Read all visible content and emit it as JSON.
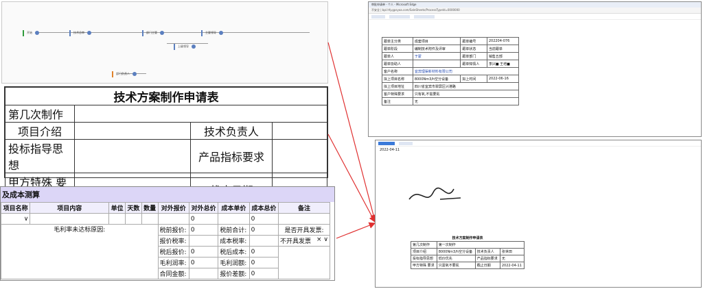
{
  "flow": {
    "nodes": [
      {
        "label": "开始"
      },
      {
        "label": "技术总审"
      },
      {
        "label": "部门主管"
      },
      {
        "label": "上级领导"
      },
      {
        "label": "主要领导"
      },
      {
        "label": "部门负责人"
      }
    ]
  },
  "request_form": {
    "title": "技术方案制作申请表",
    "rows": [
      {
        "label": "第几次制作",
        "right_label": ""
      },
      {
        "label": "项目介绍",
        "right_label": "技术负责人"
      },
      {
        "label": "投标指导思想",
        "right_label": "产品指标要求"
      },
      {
        "label": "甲方特殊 要求",
        "right_label": "截止日期"
      }
    ]
  },
  "cost": {
    "header": "及成本测算",
    "columns": [
      "项目名称",
      "项目内容",
      "单位",
      "天数",
      "数量",
      "对外报价",
      "对外总价",
      "成本单价",
      "成本总价",
      "备注"
    ],
    "row_values": {
      "quote_total": "0",
      "cost_total": "0"
    },
    "reason_label": "毛利率未达标原因:",
    "invoice_label": "是否开具发票:",
    "invoice_value": "不开具发票",
    "summary": [
      {
        "l1": "税前报价:",
        "v1": "0",
        "l2": "税前合计:",
        "v2": "0"
      },
      {
        "l1": "报价税率:",
        "v1": "",
        "l2": "成本税率:",
        "v2": ""
      },
      {
        "l1": "税后报价:",
        "v1": "0",
        "l2": "税后成本:",
        "v2": "0"
      },
      {
        "l1": "毛利润率:",
        "v1": "0",
        "l2": "毛利润额:",
        "v2": "0"
      },
      {
        "l1": "合同金额:",
        "v1": "",
        "l2": "报价差额:",
        "v2": "0"
      }
    ]
  },
  "window_a": {
    "title": "审批申请单 - 个人 - Microsoft Edge",
    "address": "不安全 | bpl.hfy.gpsyoa.com/SaleSheets/ProcessTypeId=0000000",
    "form": [
      {
        "l1": "跟单主分类",
        "v1": "成套项目",
        "l2": "跟单编号",
        "v2": "202204-076"
      },
      {
        "l1": "跟单阶段",
        "v1": "编制技术附件及评审",
        "l2": "跟单状态",
        "v2": "当前跟单"
      },
      {
        "l1": "跟单人",
        "v1": "于蒙",
        "l2": "跟单部门",
        "v2": "销售五部"
      },
      {
        "l1": "跟单协助人",
        "v1": "",
        "l2": "跟单知情人",
        "v2": "李兴■ 王培■"
      },
      {
        "l1": "客户名称",
        "v1": "宜宾理渠新材料有限公司",
        "l2": "",
        "v2": ""
      },
      {
        "l1": "拟上项目名称",
        "v1": "8000Nm3/h空分设备",
        "l2": "拟上时间",
        "v2": "2022-06-16"
      },
      {
        "l1": "拟上项目地址",
        "v1": "四川省宜宾市翠屏区兴港路",
        "l2": "",
        "v2": ""
      },
      {
        "l1": "客户特殊要求",
        "v1": "只有氧,不需要氮",
        "l2": "",
        "v2": ""
      },
      {
        "l1": "备注",
        "v1": "无",
        "l2": "",
        "v2": ""
      }
    ]
  },
  "window_b": {
    "date": "2022-04-11",
    "form_title": "技术方案制作申请表",
    "form": [
      {
        "l1": "第几次制作",
        "v1": "第一次制作",
        "l2": "",
        "v2": ""
      },
      {
        "l1": "项目介绍",
        "v1": "8000Nm3/h空分设备",
        "l2": "技术负责人",
        "v2": "张世田"
      },
      {
        "l1": "投标指导思想",
        "v1": "低价优先",
        "l2": "产品指标要求",
        "v2": "无"
      },
      {
        "l1": "甲方特殊 要求",
        "v1": "只需氧不要氮",
        "l2": "截止日期",
        "v2": "2022-04-11"
      }
    ]
  },
  "colors": {
    "accent": "#5b7fbf",
    "arrow": "#e03030",
    "cost_header": "#dcd6f7"
  }
}
